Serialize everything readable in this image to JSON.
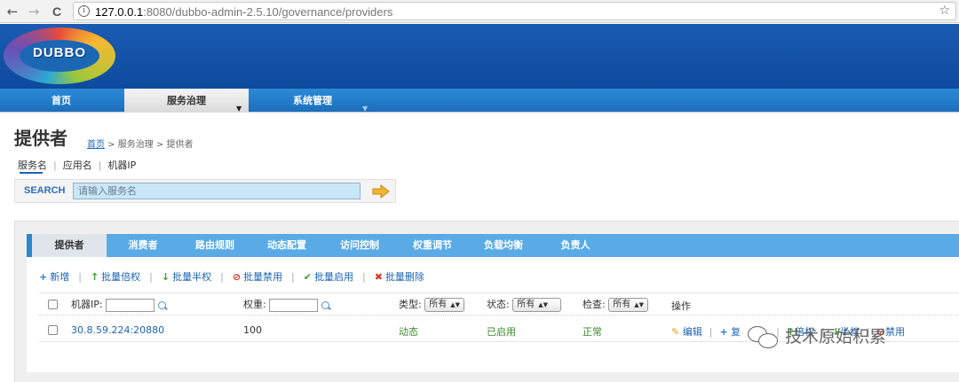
{
  "browser": {
    "back": "←",
    "forward": "→",
    "reload": "C",
    "url_host": "127.0.0.1",
    "url_rest": ":8080/dubbo-admin-2.5.10/governance/providers",
    "star": "☆"
  },
  "logo": {
    "text": "DUBBO"
  },
  "mainnav": {
    "items": [
      {
        "label": "首页"
      },
      {
        "label": "服务治理"
      },
      {
        "label": "系统管理"
      }
    ],
    "caret": "▼"
  },
  "page": {
    "title": "提供者",
    "breadcrumb": {
      "home": "首页",
      "sep1": " > ",
      "mid": "服务治理",
      "sep2": " > ",
      "current": "提供者"
    }
  },
  "search": {
    "tabs": [
      "服务名",
      "应用名",
      "机器IP"
    ],
    "sep": "|",
    "label": "SEARCH",
    "placeholder": "请输入服务名"
  },
  "subtabs": [
    "提供者",
    "消费者",
    "路由规则",
    "动态配置",
    "访问控制",
    "权重调节",
    "负载均衡",
    "负责人"
  ],
  "actions": [
    {
      "icon": "+",
      "label": "新增"
    },
    {
      "icon": "↑",
      "label": "批量倍权"
    },
    {
      "icon": "↓",
      "label": "批量半权"
    },
    {
      "icon": "⊘",
      "label": "批量禁用"
    },
    {
      "icon": "✔",
      "label": "批量启用"
    },
    {
      "icon": "✖",
      "label": "批量删除"
    }
  ],
  "table": {
    "headers": {
      "ip": "机器IP:",
      "weight": "权重:",
      "type": "类型:",
      "type_value": "所有",
      "status": "状态:",
      "status_value": "所有",
      "check": "检查:",
      "check_value": "所有",
      "ops": "操作"
    },
    "rows": [
      {
        "ip": "30.8.59.224:20880",
        "weight": "100",
        "type": "动态",
        "status": "已启用",
        "check": "正常"
      }
    ],
    "ops": [
      {
        "icon": "✎",
        "label": "编辑"
      },
      {
        "icon": "+",
        "label": "复"
      },
      {
        "icon": "↑",
        "label": "倍权"
      },
      {
        "icon": "↓",
        "label": "半权"
      },
      {
        "icon": "⊘",
        "label": "禁用"
      }
    ]
  },
  "watermark": {
    "text": "技术原始积累"
  },
  "colors": {
    "header": "#1a5cb3",
    "nav": "#2a8ad6",
    "subtab_bar": "#5aaae6",
    "link": "#1c64b4",
    "green": "#3a8a2a"
  }
}
